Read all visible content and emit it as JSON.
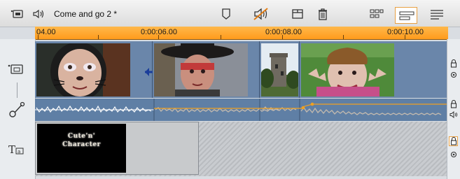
{
  "toolbar": {
    "project_title": "Come and go 2 *",
    "icons": [
      "video-monitor-icon",
      "audio-speaker-icon",
      "marker-icon",
      "mute-icon",
      "split-clip-icon",
      "trash-icon",
      "storyboard-view-icon",
      "timeline-view-icon",
      "text-view-icon"
    ]
  },
  "ruler": {
    "labels": [
      "04.00",
      "0:00:06.00",
      "0:00:08.00",
      "0:00:10.00"
    ]
  },
  "tracks": {
    "video": {
      "icon": "video-track-icon"
    },
    "audio": {
      "icon": "audio-track-icon"
    },
    "title": {
      "icon": "title-track-icon",
      "clip_text_line1": "Cute'n'",
      "clip_text_line2": "Character"
    }
  },
  "colors": {
    "ruler": "#ff9b1c",
    "track": "#5f7fa5",
    "active_view": "#e8a043"
  }
}
